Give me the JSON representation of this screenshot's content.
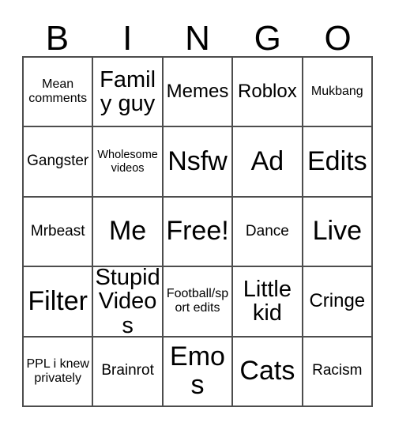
{
  "card": {
    "title": "Bingo Card",
    "background_color": "#ffffff",
    "grid_line_color": "#4d4d4d",
    "text_color": "#000000",
    "header": {
      "letters": [
        "B",
        "I",
        "N",
        "G",
        "O"
      ]
    },
    "rows": [
      [
        {
          "text": "Mean comments",
          "size": "sm"
        },
        {
          "text": "Family guy",
          "size": "xl"
        },
        {
          "text": "Memes",
          "size": "lg"
        },
        {
          "text": "Roblox",
          "size": "lg"
        },
        {
          "text": "Mukbang",
          "size": "sm"
        }
      ],
      [
        {
          "text": "Gangster",
          "size": "md"
        },
        {
          "text": "Wholesome videos",
          "size": "xs"
        },
        {
          "text": "Nsfw",
          "size": "xxl"
        },
        {
          "text": "Ad",
          "size": "xxl"
        },
        {
          "text": "Edits",
          "size": "xxl"
        }
      ],
      [
        {
          "text": "Mrbeast",
          "size": "md"
        },
        {
          "text": "Me",
          "size": "xxl"
        },
        {
          "text": "Free!",
          "size": "xxl"
        },
        {
          "text": "Dance",
          "size": "md"
        },
        {
          "text": "Live",
          "size": "xxl"
        }
      ],
      [
        {
          "text": "Filter",
          "size": "xxl"
        },
        {
          "text": "Stupid Videos",
          "size": "xl"
        },
        {
          "text": "Football/sport edits",
          "size": "sm"
        },
        {
          "text": "Little kid",
          "size": "xl"
        },
        {
          "text": "Cringe",
          "size": "lg"
        }
      ],
      [
        {
          "text": "PPL i knew privately",
          "size": "sm"
        },
        {
          "text": "Brainrot",
          "size": "md"
        },
        {
          "text": "Emos",
          "size": "xxl"
        },
        {
          "text": "Cats",
          "size": "xxl"
        },
        {
          "text": "Racism",
          "size": "md"
        }
      ]
    ]
  }
}
